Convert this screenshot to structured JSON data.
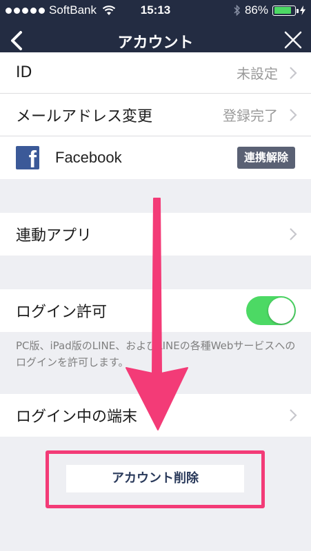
{
  "status_bar": {
    "carrier": "SoftBank",
    "time": "15:13",
    "battery_percent": "86%",
    "battery_level": 0.86
  },
  "nav": {
    "title": "アカウント"
  },
  "rows": {
    "id": {
      "label": "ID",
      "value": "未設定"
    },
    "email": {
      "label": "メールアドレス変更",
      "value": "登録完了"
    },
    "facebook": {
      "label": "Facebook",
      "button": "連携解除"
    },
    "apps": {
      "label": "連動アプリ"
    },
    "login_permit": {
      "label": "ログイン許可",
      "enabled": true
    },
    "devices": {
      "label": "ログイン中の端末"
    }
  },
  "note": "PC版、iPad版のLINE、およびLINEの各種Webサービスへのログインを許可します。",
  "delete_button": "アカウント削除",
  "colors": {
    "navbar": "#232c42",
    "toggle_on": "#4cd964",
    "highlight": "#f33b77",
    "facebook": "#3b5998"
  }
}
